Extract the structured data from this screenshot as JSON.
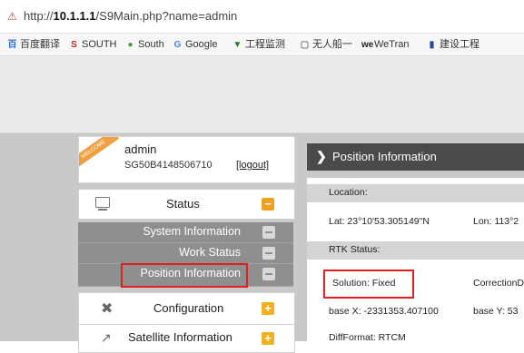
{
  "browser": {
    "url_prefix": "http://",
    "url_host": "10.1.1.1",
    "url_path": "/S9Main.php?name=admin",
    "bookmarks": [
      {
        "label": "百度翻译",
        "icon": "百",
        "color": "#2f6fd8"
      },
      {
        "label": "SOUTH",
        "icon": "S",
        "color": "#d81e1e"
      },
      {
        "label": "South",
        "icon": "●",
        "color": "#3a9a3a"
      },
      {
        "label": "Google",
        "icon": "G",
        "color": "#4a86e8"
      },
      {
        "label": "工程监测",
        "icon": "▼",
        "color": "#2a7a2a"
      },
      {
        "label": "无人船一",
        "icon": "▢",
        "color": "#777777"
      },
      {
        "label": "WeTran",
        "icon": "we",
        "color": "#222222"
      },
      {
        "label": "建设工程",
        "icon": "▮",
        "color": "#1a4fa0"
      }
    ]
  },
  "user": {
    "ribbon": "WELCOME",
    "name": "admin",
    "serial": "SG50B4148506710",
    "logout": "[logout]"
  },
  "menu": {
    "status_label": "Status",
    "status_toggle": "−",
    "sub_items": [
      {
        "label": "System Information"
      },
      {
        "label": "Work Status"
      },
      {
        "label": "Position Information"
      }
    ],
    "configuration_label": "Configuration",
    "configuration_toggle": "+",
    "satellite_label": "Satellite Information",
    "satellite_toggle": "+"
  },
  "panel": {
    "title": "Position Information",
    "location_header": "Location:",
    "lat": "Lat: 23°10'53.305149\"N",
    "lon": "Lon: 113°2",
    "rtk_header": "RTK Status:",
    "solution": "Solution: Fixed",
    "correction": "CorrectionD",
    "base_x": "base X: -2331353.407100",
    "base_y": "base Y: 53",
    "diff_format": "DiffFormat: RTCM"
  },
  "colors": {
    "highlight_box": "#e02020",
    "submenu_bg": "#8f8f8f",
    "panel_head_bg": "#4a4a4a",
    "accent_orange": "#f0a020"
  }
}
